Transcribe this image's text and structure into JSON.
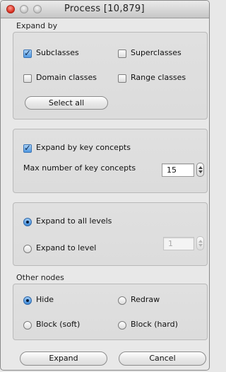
{
  "window": {
    "title": "Process [10,879]"
  },
  "expand_by": {
    "label": "Expand by",
    "subclasses": {
      "label": "Subclasses",
      "checked": true
    },
    "superclasses": {
      "label": "Superclasses",
      "checked": false
    },
    "domain_classes": {
      "label": "Domain classes",
      "checked": false
    },
    "range_classes": {
      "label": "Range classes",
      "checked": false
    },
    "select_all_label": "Select all"
  },
  "key_concepts": {
    "expand_label": "Expand by key concepts",
    "expand_checked": true,
    "max_label": "Max number of key concepts",
    "max_value": "15"
  },
  "levels": {
    "all_levels_label": "Expand to all levels",
    "all_levels_selected": true,
    "to_level_label": "Expand to level",
    "level_value": "1",
    "level_disabled": true
  },
  "other_nodes": {
    "label": "Other nodes",
    "hide": {
      "label": "Hide",
      "selected": true
    },
    "redraw": {
      "label": "Redraw",
      "selected": false
    },
    "block_soft": {
      "label": "Block (soft)",
      "selected": false
    },
    "block_hard": {
      "label": "Block (hard)",
      "selected": false
    }
  },
  "footer": {
    "expand_label": "Expand",
    "cancel_label": "Cancel"
  }
}
